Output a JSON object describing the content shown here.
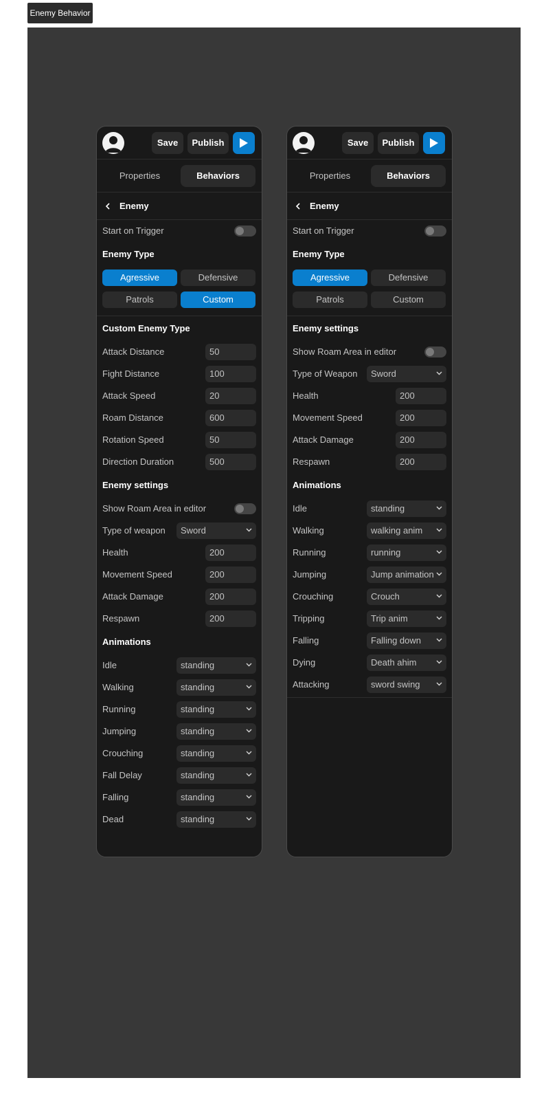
{
  "frame_label": "Enemy Behavior",
  "colors": {
    "accent": "#0a7fce",
    "canvas": "#383838",
    "panel": "#191919",
    "control": "#2b2b2b"
  },
  "left": {
    "header": {
      "save": "Save",
      "publish": "Publish"
    },
    "tabs": {
      "properties": "Properties",
      "behaviors": "Behaviors"
    },
    "breadcrumb": "Enemy",
    "start_on_trigger": "Start on Trigger",
    "enemy_type": {
      "title": "Enemy Type",
      "options": [
        "Agressive",
        "Defensive",
        "Patrols",
        "Custom"
      ],
      "selected": [
        "Agressive",
        "Custom"
      ]
    },
    "custom": {
      "title": "Custom Enemy Type",
      "rows": [
        {
          "label": "Attack Distance",
          "value": "50"
        },
        {
          "label": "Fight Distance",
          "value": "100"
        },
        {
          "label": "Attack Speed",
          "value": "20"
        },
        {
          "label": "Roam Distance",
          "value": "600"
        },
        {
          "label": "Rotation Speed",
          "value": "50"
        },
        {
          "label": "Direction Duration",
          "value": "500"
        }
      ]
    },
    "settings": {
      "title": "Enemy settings",
      "show_roam": "Show Roam Area in editor",
      "weapon_label": "Type of weapon",
      "weapon_value": "Sword",
      "rows": [
        {
          "label": "Health",
          "value": "200"
        },
        {
          "label": "Movement Speed",
          "value": "200"
        },
        {
          "label": "Attack Damage",
          "value": "200"
        },
        {
          "label": "Respawn",
          "value": "200"
        }
      ]
    },
    "animations": {
      "title": "Animations",
      "rows": [
        {
          "label": "Idle",
          "value": "standing"
        },
        {
          "label": "Walking",
          "value": "standing"
        },
        {
          "label": "Running",
          "value": "standing"
        },
        {
          "label": "Jumping",
          "value": "standing"
        },
        {
          "label": "Crouching",
          "value": "standing"
        },
        {
          "label": "Fall Delay",
          "value": "standing"
        },
        {
          "label": "Falling",
          "value": "standing"
        },
        {
          "label": "Dead",
          "value": "standing"
        }
      ]
    }
  },
  "right": {
    "header": {
      "save": "Save",
      "publish": "Publish"
    },
    "tabs": {
      "properties": "Properties",
      "behaviors": "Behaviors"
    },
    "breadcrumb": "Enemy",
    "start_on_trigger": "Start on Trigger",
    "enemy_type": {
      "title": "Enemy Type",
      "options": [
        "Agressive",
        "Defensive",
        "Patrols",
        "Custom"
      ],
      "selected": [
        "Agressive"
      ]
    },
    "settings": {
      "title": "Enemy settings",
      "show_roam": "Show Roam Area in editor",
      "weapon_label": "Type of Weapon",
      "weapon_value": "Sword",
      "rows": [
        {
          "label": "Health",
          "value": "200"
        },
        {
          "label": "Movement Speed",
          "value": "200"
        },
        {
          "label": "Attack Damage",
          "value": "200"
        },
        {
          "label": "Respawn",
          "value": "200"
        }
      ]
    },
    "animations": {
      "title": "Animations",
      "rows": [
        {
          "label": "Idle",
          "value": "standing"
        },
        {
          "label": "Walking",
          "value": "walking anim"
        },
        {
          "label": "Running",
          "value": "running"
        },
        {
          "label": "Jumping",
          "value": "Jump animation"
        },
        {
          "label": "Crouching",
          "value": "Crouch"
        },
        {
          "label": "Tripping",
          "value": "Trip anim"
        },
        {
          "label": "Falling",
          "value": "Falling down"
        },
        {
          "label": "Dying",
          "value": "Death ahim"
        },
        {
          "label": "Attacking",
          "value": "sword swing"
        }
      ]
    }
  }
}
